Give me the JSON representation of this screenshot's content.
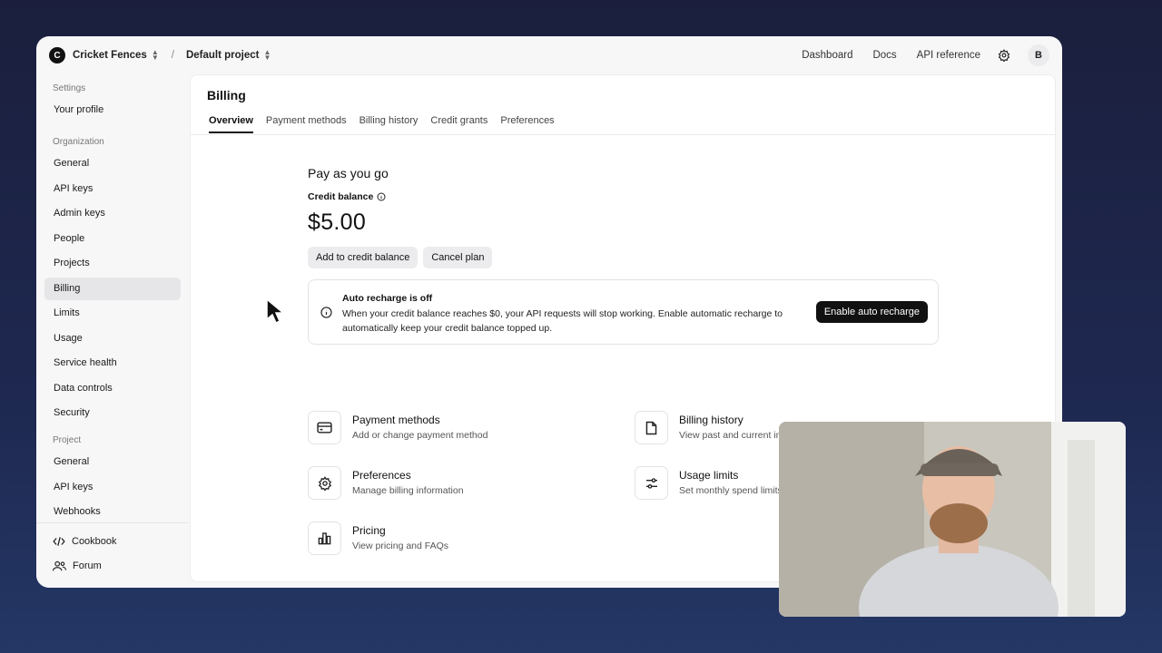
{
  "topbar": {
    "org_initial": "C",
    "org_name": "Cricket Fences",
    "separator": "/",
    "project_name": "Default project",
    "links": [
      "Dashboard",
      "Docs",
      "API reference"
    ],
    "user_initial": "B"
  },
  "sidebar": {
    "groups": {
      "settings": "Settings",
      "organization": "Organization",
      "project": "Project"
    },
    "settings_items": [
      "Your profile"
    ],
    "org_items": [
      "General",
      "API keys",
      "Admin keys",
      "People",
      "Projects",
      "Billing",
      "Limits",
      "Usage",
      "Service health",
      "Data controls",
      "Security"
    ],
    "project_items": [
      "General",
      "API keys",
      "Webhooks"
    ],
    "active_item": "Billing",
    "footer": [
      "Cookbook",
      "Forum"
    ]
  },
  "main": {
    "title": "Billing",
    "tabs": [
      "Overview",
      "Payment methods",
      "Billing history",
      "Credit grants",
      "Preferences"
    ],
    "active_tab": "Overview",
    "plan_title": "Pay as you go",
    "credit_label": "Credit balance",
    "balance": "$5.00",
    "buttons": [
      "Add to credit balance",
      "Cancel plan"
    ],
    "notice": {
      "title": "Auto recharge is off",
      "body": "When your credit balance reaches $0, your API requests will stop working. Enable automatic recharge to automatically keep your credit balance topped up.",
      "button": "Enable auto recharge"
    },
    "cards": [
      {
        "title": "Payment methods",
        "desc": "Add or change payment method",
        "icon": "credit-card-icon"
      },
      {
        "title": "Billing history",
        "desc": "View past and current invoices",
        "icon": "document-icon"
      },
      {
        "title": "Preferences",
        "desc": "Manage billing information",
        "icon": "gear-icon"
      },
      {
        "title": "Usage limits",
        "desc": "Set monthly spend limits",
        "icon": "sliders-icon"
      },
      {
        "title": "Pricing",
        "desc": "View pricing and FAQs",
        "icon": "bar-chart-icon"
      }
    ]
  }
}
